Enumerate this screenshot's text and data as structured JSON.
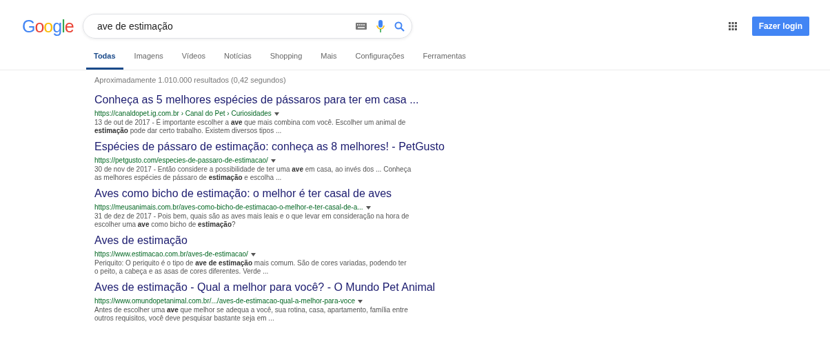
{
  "logo": "Google",
  "search": {
    "value": "ave de estimação"
  },
  "tabs": [
    {
      "label": "Todas",
      "selected": true
    },
    {
      "label": "Imagens",
      "selected": false
    },
    {
      "label": "Vídeos",
      "selected": false
    },
    {
      "label": "Notícias",
      "selected": false
    },
    {
      "label": "Shopping",
      "selected": false
    },
    {
      "label": "Mais",
      "selected": false
    },
    {
      "label": "Configurações",
      "selected": false
    },
    {
      "label": "Ferramentas",
      "selected": false
    }
  ],
  "login_button": "Fazer login",
  "result_stats": "Aproximadamente 1.010.000 resultados (0,42 segundos)",
  "results": [
    {
      "title": "Conheça as 5 melhores espécies de pássaros para ter em casa ...",
      "url": "https://canaldopet.ig.com.br › Canal do Pet › Curiosidades",
      "snippet": "13 de out de 2017 - É importante escolher a **ave** que mais combina com você. Escolher um animal de **estimação** pode dar certo trabalho. Existem diversos tipos ..."
    },
    {
      "title": "Espécies de pássaro de estimação: conheça as 8 melhores! - PetGusto",
      "url": "https://petgusto.com/especies-de-passaro-de-estimacao/",
      "snippet": "30 de nov de 2017 - Então considere a possibilidade de ter uma **ave** em casa, ao invés dos ... Conheça as melhores espécies de pássaro de **estimação** e escolha ..."
    },
    {
      "title": "Aves como bicho de estimação: o melhor é ter casal de aves",
      "url": "https://meusanimais.com.br/aves-como-bicho-de-estimacao-o-melhor-e-ter-casal-de-a...",
      "snippet": "31 de dez de 2017 - Pois bem, quais são as aves mais leais e o que levar em consideração na hora de escolher uma **ave** como bicho de **estimação**?"
    },
    {
      "title": "Aves de estimação",
      "url": "https://www.estimacao.com.br/aves-de-estimacao/",
      "snippet": "Periquito: O periquito é o tipo de **ave de estimação** mais comum. São de cores variadas, podendo ter o peito, a cabeça e as asas de cores diferentes. Verde ..."
    },
    {
      "title": "Aves de estimação - Qual a melhor para você? - O Mundo Pet Animal",
      "url": "https://www.omundopetanimal.com.br/.../aves-de-estimacao-qual-a-melhor-para-voce",
      "snippet": "Antes de escolher uma **ave** que melhor se adequa a você, sua rotina, casa, apartamento, família entre outros requisitos, você deve pesquisar bastante seja em ..."
    }
  ]
}
